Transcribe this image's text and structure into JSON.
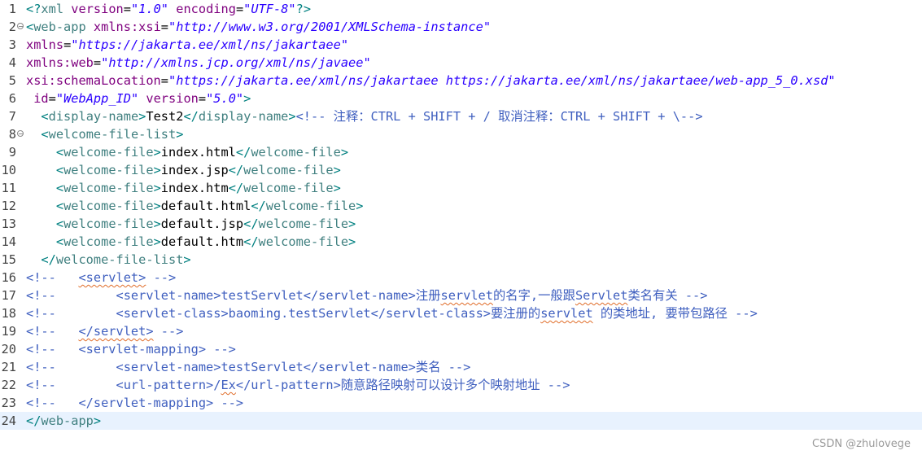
{
  "editor": {
    "current_line": 24,
    "lines": [
      {
        "n": "1",
        "fold": false,
        "tokens": [
          [
            "t-bracket",
            "<?"
          ],
          [
            "t-tag",
            "xml"
          ],
          [
            "t-text",
            " "
          ],
          [
            "t-attr",
            "version"
          ],
          [
            "t-text",
            "="
          ],
          [
            "t-val",
            "\"1.0\""
          ],
          [
            "t-text",
            " "
          ],
          [
            "t-attr",
            "encoding"
          ],
          [
            "t-text",
            "="
          ],
          [
            "t-val",
            "\"UTF-8\""
          ],
          [
            "t-bracket",
            "?>"
          ]
        ]
      },
      {
        "n": "2",
        "fold": true,
        "tokens": [
          [
            "t-bracket",
            "<"
          ],
          [
            "t-tag",
            "web-app"
          ],
          [
            "t-text",
            " "
          ],
          [
            "t-attr",
            "xmlns:xsi"
          ],
          [
            "t-text",
            "="
          ],
          [
            "t-val",
            "\"http://www.w3.org/2001/XMLSchema-instance\""
          ]
        ]
      },
      {
        "n": "3",
        "fold": false,
        "tokens": [
          [
            "t-attr",
            "xmlns"
          ],
          [
            "t-text",
            "="
          ],
          [
            "t-val",
            "\"https://jakarta.ee/xml/ns/jakartaee\""
          ]
        ]
      },
      {
        "n": "4",
        "fold": false,
        "tokens": [
          [
            "t-attr",
            "xmlns:web"
          ],
          [
            "t-text",
            "="
          ],
          [
            "t-val",
            "\"http://xmlns.jcp.org/xml/ns/javaee\""
          ]
        ]
      },
      {
        "n": "5",
        "fold": false,
        "tokens": [
          [
            "t-attr",
            "xsi:schemaLocation"
          ],
          [
            "t-text",
            "="
          ],
          [
            "t-val",
            "\"https://jakarta.ee/xml/ns/jakartaee https://jakarta.ee/xml/ns/jakartaee/web-app_5_0.xsd\""
          ]
        ]
      },
      {
        "n": "6",
        "fold": false,
        "tokens": [
          [
            "t-text",
            " "
          ],
          [
            "t-attr",
            "id"
          ],
          [
            "t-text",
            "="
          ],
          [
            "t-val",
            "\"WebApp_ID\""
          ],
          [
            "t-text",
            " "
          ],
          [
            "t-attr",
            "version"
          ],
          [
            "t-text",
            "="
          ],
          [
            "t-val",
            "\"5.0\""
          ],
          [
            "t-bracket",
            ">"
          ]
        ]
      },
      {
        "n": "7",
        "fold": false,
        "tokens": [
          [
            "t-text",
            "  "
          ],
          [
            "t-bracket",
            "<"
          ],
          [
            "t-tag",
            "display-name"
          ],
          [
            "t-bracket",
            ">"
          ],
          [
            "t-text",
            "Test2"
          ],
          [
            "t-bracket",
            "</"
          ],
          [
            "t-tag",
            "display-name"
          ],
          [
            "t-bracket",
            ">"
          ],
          [
            "t-comment",
            "<!-- 注释：CTRL + SHIFT + / 取消注释：CTRL + SHIFT + \\-->"
          ]
        ]
      },
      {
        "n": "8",
        "fold": true,
        "tokens": [
          [
            "t-text",
            "  "
          ],
          [
            "t-bracket",
            "<"
          ],
          [
            "t-tag",
            "welcome-file-list"
          ],
          [
            "t-bracket",
            ">"
          ]
        ]
      },
      {
        "n": "9",
        "fold": false,
        "tokens": [
          [
            "t-text",
            "    "
          ],
          [
            "t-bracket",
            "<"
          ],
          [
            "t-tag",
            "welcome-file"
          ],
          [
            "t-bracket",
            ">"
          ],
          [
            "t-text",
            "index.html"
          ],
          [
            "t-bracket",
            "</"
          ],
          [
            "t-tag",
            "welcome-file"
          ],
          [
            "t-bracket",
            ">"
          ]
        ]
      },
      {
        "n": "10",
        "fold": false,
        "tokens": [
          [
            "t-text",
            "    "
          ],
          [
            "t-bracket",
            "<"
          ],
          [
            "t-tag",
            "welcome-file"
          ],
          [
            "t-bracket",
            ">"
          ],
          [
            "t-text",
            "index.jsp"
          ],
          [
            "t-bracket",
            "</"
          ],
          [
            "t-tag",
            "welcome-file"
          ],
          [
            "t-bracket",
            ">"
          ]
        ]
      },
      {
        "n": "11",
        "fold": false,
        "tokens": [
          [
            "t-text",
            "    "
          ],
          [
            "t-bracket",
            "<"
          ],
          [
            "t-tag",
            "welcome-file"
          ],
          [
            "t-bracket",
            ">"
          ],
          [
            "t-text",
            "index.htm"
          ],
          [
            "t-bracket",
            "</"
          ],
          [
            "t-tag",
            "welcome-file"
          ],
          [
            "t-bracket",
            ">"
          ]
        ]
      },
      {
        "n": "12",
        "fold": false,
        "tokens": [
          [
            "t-text",
            "    "
          ],
          [
            "t-bracket",
            "<"
          ],
          [
            "t-tag",
            "welcome-file"
          ],
          [
            "t-bracket",
            ">"
          ],
          [
            "t-text",
            "default.html"
          ],
          [
            "t-bracket",
            "</"
          ],
          [
            "t-tag",
            "welcome-file"
          ],
          [
            "t-bracket",
            ">"
          ]
        ]
      },
      {
        "n": "13",
        "fold": false,
        "tokens": [
          [
            "t-text",
            "    "
          ],
          [
            "t-bracket",
            "<"
          ],
          [
            "t-tag",
            "welcome-file"
          ],
          [
            "t-bracket",
            ">"
          ],
          [
            "t-text",
            "default.jsp"
          ],
          [
            "t-bracket",
            "</"
          ],
          [
            "t-tag",
            "welcome-file"
          ],
          [
            "t-bracket",
            ">"
          ]
        ]
      },
      {
        "n": "14",
        "fold": false,
        "tokens": [
          [
            "t-text",
            "    "
          ],
          [
            "t-bracket",
            "<"
          ],
          [
            "t-tag",
            "welcome-file"
          ],
          [
            "t-bracket",
            ">"
          ],
          [
            "t-text",
            "default.htm"
          ],
          [
            "t-bracket",
            "</"
          ],
          [
            "t-tag",
            "welcome-file"
          ],
          [
            "t-bracket",
            ">"
          ]
        ]
      },
      {
        "n": "15",
        "fold": false,
        "tokens": [
          [
            "t-text",
            "  "
          ],
          [
            "t-bracket",
            "</"
          ],
          [
            "t-tag",
            "welcome-file-list"
          ],
          [
            "t-bracket",
            ">"
          ]
        ]
      },
      {
        "n": "16",
        "fold": false,
        "tokens": [
          [
            "t-comment",
            "<!--   "
          ],
          [
            "t-comment squig",
            "<servlet>"
          ],
          [
            "t-comment",
            " -->"
          ]
        ]
      },
      {
        "n": "17",
        "fold": false,
        "tokens": [
          [
            "t-comment",
            "<!--        <servlet-name>testServlet</servlet-name>注册"
          ],
          [
            "t-comment squig",
            "servlet"
          ],
          [
            "t-comment",
            "的名字,一般跟"
          ],
          [
            "t-comment squig",
            "Servlet"
          ],
          [
            "t-comment",
            "类名有关 -->"
          ]
        ]
      },
      {
        "n": "18",
        "fold": false,
        "tokens": [
          [
            "t-comment",
            "<!--        <servlet-class>baoming.testServlet</servlet-class>要注册的"
          ],
          [
            "t-comment squig",
            "servlet"
          ],
          [
            "t-comment",
            " 的类地址, 要带包路径 -->"
          ]
        ]
      },
      {
        "n": "19",
        "fold": false,
        "tokens": [
          [
            "t-comment",
            "<!--   "
          ],
          [
            "t-comment squig",
            "</servlet>"
          ],
          [
            "t-comment",
            " -->"
          ]
        ]
      },
      {
        "n": "20",
        "fold": false,
        "tokens": [
          [
            "t-comment",
            "<!--   <servlet-mapping> -->"
          ]
        ]
      },
      {
        "n": "21",
        "fold": false,
        "tokens": [
          [
            "t-comment",
            "<!--        <servlet-name>testServlet</servlet-name>类名 -->"
          ]
        ]
      },
      {
        "n": "22",
        "fold": false,
        "tokens": [
          [
            "t-comment",
            "<!--        <url-pattern>/"
          ],
          [
            "t-comment squig",
            "Ex"
          ],
          [
            "t-comment",
            "</url-pattern>随意路径映射可以设计多个映射地址 -->"
          ]
        ]
      },
      {
        "n": "23",
        "fold": false,
        "tokens": [
          [
            "t-comment",
            "<!--   </servlet-mapping> -->"
          ]
        ]
      },
      {
        "n": "24",
        "fold": false,
        "tokens": [
          [
            "t-bracket",
            "</"
          ],
          [
            "t-tag",
            "web-app"
          ],
          [
            "t-bracket",
            ">"
          ]
        ]
      }
    ]
  },
  "watermark": "CSDN @zhulovege"
}
